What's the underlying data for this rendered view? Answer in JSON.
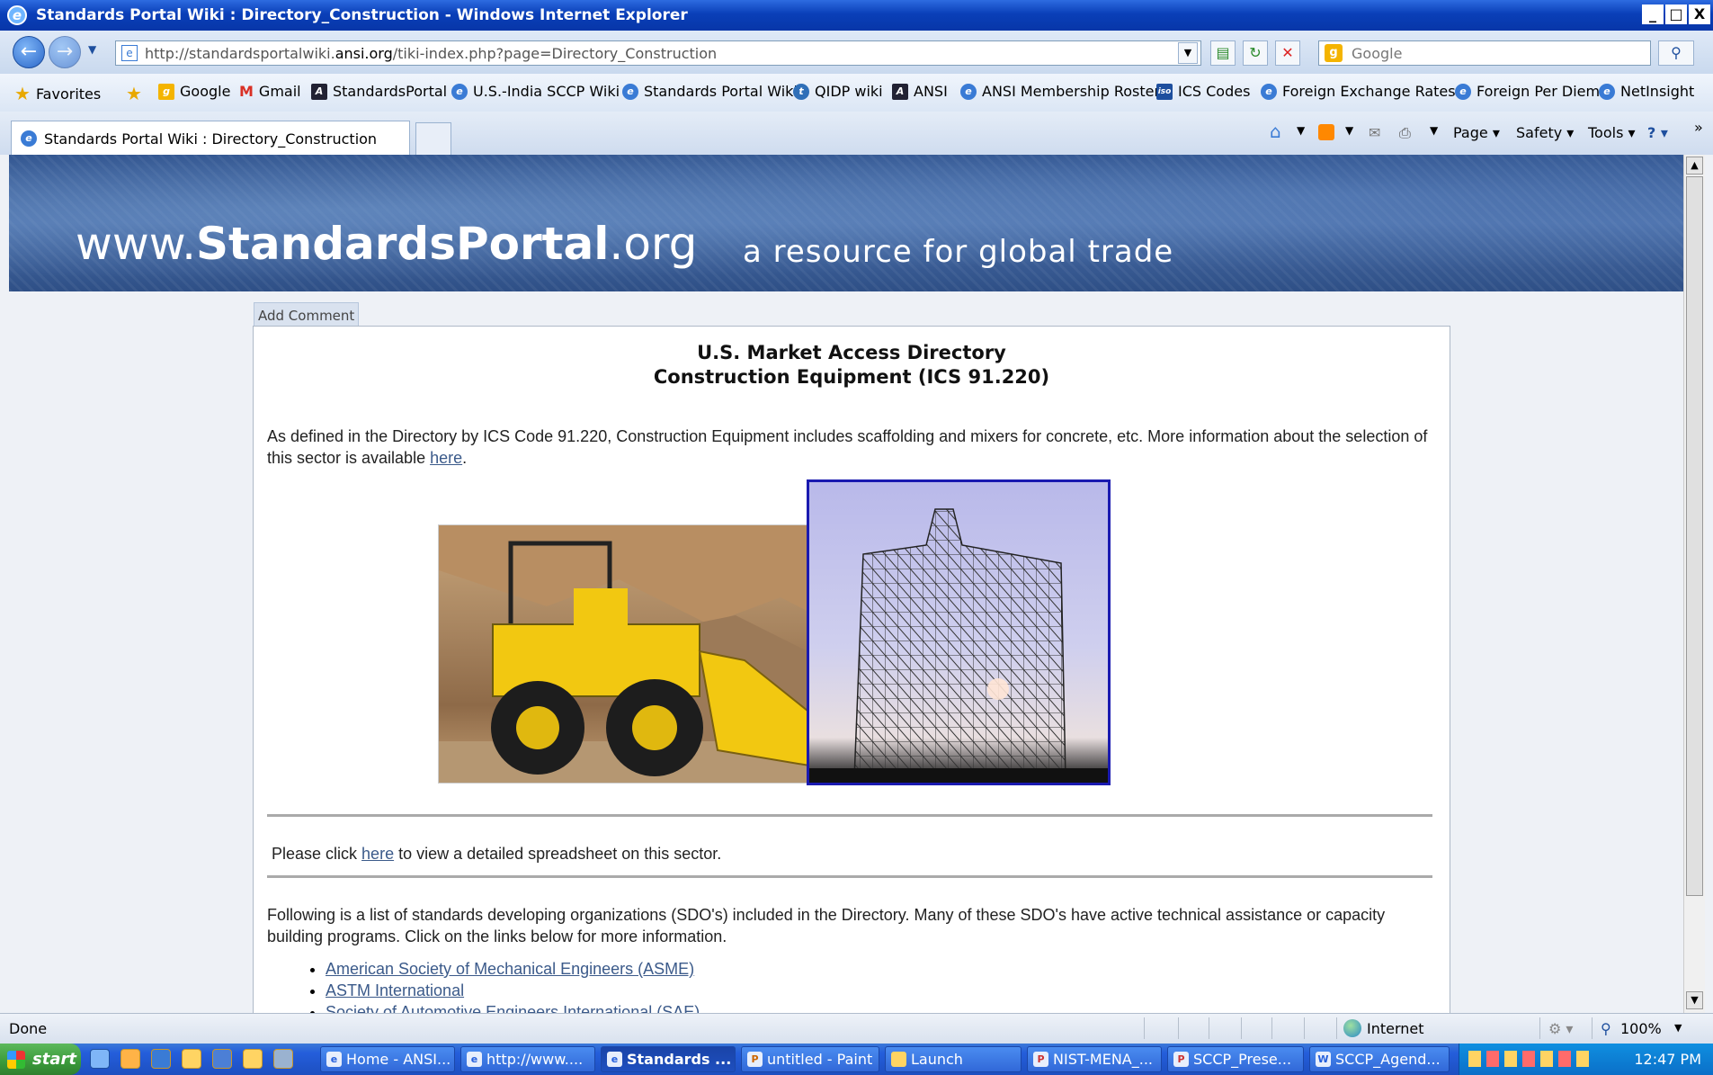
{
  "window": {
    "title": "Standards Portal Wiki : Directory_Construction - Windows Internet Explorer",
    "controls": [
      "_",
      "□",
      "X"
    ]
  },
  "address": {
    "url_prefix": "http://standardsportalwiki.",
    "url_domain": "ansi.org",
    "url_suffix": "/tiki-index.php?page=Directory_Construction",
    "search_placeholder": "Google"
  },
  "favorites": {
    "label": "Favorites",
    "items": [
      "Google",
      "Gmail",
      "StandardsPortal",
      "U.S.-India SCCP Wiki",
      "Standards Portal Wiki",
      "QIDP wiki",
      "ANSI",
      "ANSI Membership Roster",
      "ICS Codes",
      "Foreign Exchange Rates",
      "Foreign Per Diem",
      "NetInsight"
    ],
    "more": "»"
  },
  "tabs": {
    "active": "Standards Portal Wiki : Directory_Construction"
  },
  "commands": {
    "page": "Page ▾",
    "safety": "Safety ▾",
    "tools": "Tools ▾",
    "help": "? ▾"
  },
  "banner": {
    "site_prefix": "www.",
    "site_bold": "StandardsPortal",
    "site_suffix": ".org",
    "tagline": "a resource for global trade"
  },
  "content": {
    "add_comment": "Add Comment",
    "heading_line1": "U.S. Market Access Directory",
    "heading_line2": "Construction Equipment (ICS 91.220)",
    "intro_text": "As defined in the Directory by ICS Code 91.220, Construction Equipment includes scaffolding and mixers for concrete, etc.  More information about the selection of this sector is available ",
    "intro_link": "here",
    "intro_end": ".",
    "spreadsheet_pre": "Please click ",
    "spreadsheet_link": "here",
    "spreadsheet_post": " to view a detailed spreadsheet on this sector.",
    "sdo_text": "Following is a list of standards developing organizations (SDO's) included in the Directory.  Many of these SDO's have active technical assistance or capacity building programs.  Click on the links below for more information.",
    "sdo_links": [
      "American Society of Mechanical Engineers (ASME)",
      "ASTM International",
      "Society of Automotive Engineers International (SAE)"
    ]
  },
  "status": {
    "text": "Done",
    "zone": "Internet",
    "zoom": "100%"
  },
  "taskbar": {
    "start": "start",
    "items": [
      "Home - ANSI...",
      "http://www....",
      "Standards ...",
      "untitled - Paint",
      "Launch",
      "NIST-MENA_...",
      "SCCP_Prese...",
      "SCCP_Agend..."
    ],
    "active_index": 2,
    "clock": "12:47 PM"
  }
}
